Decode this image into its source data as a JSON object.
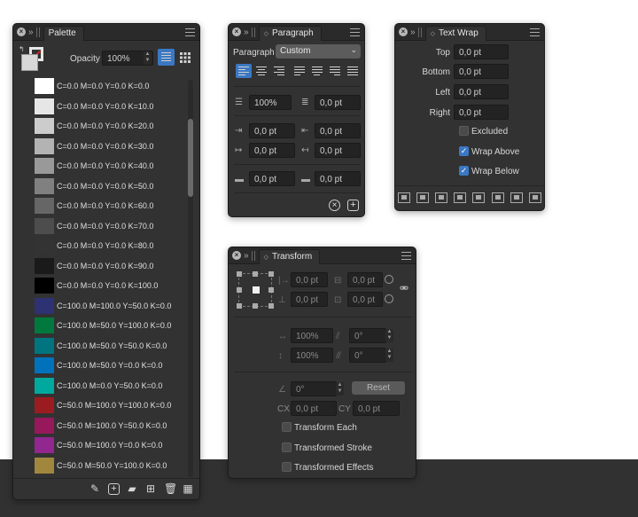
{
  "palette": {
    "title": "Palette",
    "opacity_label": "Opacity",
    "opacity_value": "100%",
    "swatches": [
      {
        "name": "C=0.0 M=0.0 Y=0.0 K=0.0",
        "color": "#ffffff"
      },
      {
        "name": "C=0.0 M=0.0 Y=0.0 K=10.0",
        "color": "#e6e6e6"
      },
      {
        "name": "C=0.0 M=0.0 Y=0.0 K=20.0",
        "color": "#cccccc"
      },
      {
        "name": "C=0.0 M=0.0 Y=0.0 K=30.0",
        "color": "#b3b3b3"
      },
      {
        "name": "C=0.0 M=0.0 Y=0.0 K=40.0",
        "color": "#999999"
      },
      {
        "name": "C=0.0 M=0.0 Y=0.0 K=50.0",
        "color": "#808080"
      },
      {
        "name": "C=0.0 M=0.0 Y=0.0 K=60.0",
        "color": "#666666"
      },
      {
        "name": "C=0.0 M=0.0 Y=0.0 K=70.0",
        "color": "#4d4d4d"
      },
      {
        "name": "C=0.0 M=0.0 Y=0.0 K=80.0",
        "color": "#333333"
      },
      {
        "name": "C=0.0 M=0.0 Y=0.0 K=90.0",
        "color": "#1a1a1a"
      },
      {
        "name": "C=0.0 M=0.0 Y=0.0 K=100.0",
        "color": "#000000"
      },
      {
        "name": "C=100.0 M=100.0 Y=50.0 K=0.0",
        "color": "#2e3172"
      },
      {
        "name": "C=100.0 M=50.0 Y=100.0 K=0.0",
        "color": "#00783e"
      },
      {
        "name": "C=100.0 M=50.0 Y=50.0 K=0.0",
        "color": "#007580"
      },
      {
        "name": "C=100.0 M=50.0 Y=0.0 K=0.0",
        "color": "#0072bc"
      },
      {
        "name": "C=100.0 M=0.0 Y=50.0 K=0.0",
        "color": "#00a99d"
      },
      {
        "name": "C=50.0 M=100.0 Y=100.0 K=0.0",
        "color": "#9b1c20"
      },
      {
        "name": "C=50.0 M=100.0 Y=50.0 K=0.0",
        "color": "#98185c"
      },
      {
        "name": "C=50.0 M=100.0 Y=0.0 K=0.0",
        "color": "#92278f"
      },
      {
        "name": "C=50.0 M=50.0 Y=100.0 K=0.0",
        "color": "#a1873e"
      }
    ]
  },
  "paragraph": {
    "title": "Paragraph",
    "style_label": "Paragraph",
    "style_value": "Custom",
    "leading": "100%",
    "space_value": "0,0 pt",
    "left_indent": "0,0 pt",
    "right_indent": "0,0 pt",
    "first_indent": "0,0 pt",
    "last_indent": "0,0 pt",
    "space_before": "0,0 pt",
    "space_after": "0,0 pt"
  },
  "textwrap": {
    "title": "Text Wrap",
    "top_label": "Top",
    "top_value": "0,0 pt",
    "bottom_label": "Bottom",
    "bottom_value": "0,0 pt",
    "left_label": "Left",
    "left_value": "0,0 pt",
    "right_label": "Right",
    "right_value": "0,0 pt",
    "excluded_label": "Excluded",
    "wrap_above_label": "Wrap Above",
    "wrap_below_label": "Wrap Below"
  },
  "transform": {
    "title": "Transform",
    "x": "0,0 pt",
    "y": "0,0 pt",
    "w": "0,0 pt",
    "h": "0,0 pt",
    "scale_x": "100%",
    "scale_y": "100%",
    "skew_x": "0°",
    "skew_y": "0°",
    "rotation": "0°",
    "reset_label": "Reset",
    "cx_label": "CX",
    "cx_value": "0,0 pt",
    "cy_label": "CY",
    "cy_value": "0,0 pt",
    "transform_each_label": "Transform Each",
    "transformed_stroke_label": "Transformed Stroke",
    "transformed_effects_label": "Transformed Effects"
  }
}
